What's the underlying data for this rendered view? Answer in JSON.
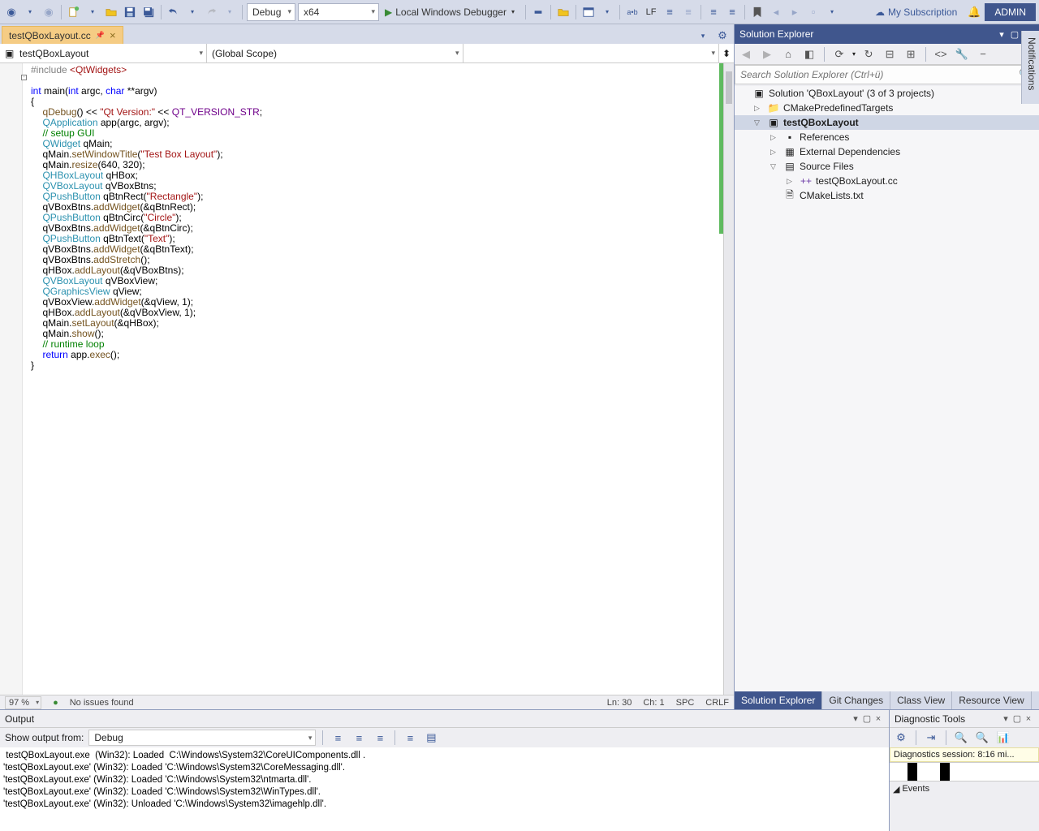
{
  "toolbar": {
    "config": "Debug",
    "platform": "x64",
    "debugger": "Local Windows Debugger",
    "lineEndingLabel": "LF",
    "subscription": "My Subscription",
    "admin": "ADMIN"
  },
  "tab": {
    "name": "testQBoxLayout.cc"
  },
  "nav": {
    "project": "testQBoxLayout",
    "scope": "(Global Scope)",
    "member": ""
  },
  "code": {
    "include": "#include ",
    "includeTarget": "<QtWidgets>",
    "intKw": "int",
    "mainFn": " main(",
    "argc": "int",
    "argcN": " argc, ",
    "charKw": "char",
    "argvN": " **argv)",
    "brace1": "{",
    "qDebug": "qDebug",
    "qDebugRest": "() << ",
    "verStr": "\"Qt Version:\"",
    "llt": " << ",
    "verMac": "QT_VERSION_STR",
    "semi": ";",
    "QApplication": "QApplication",
    "appDecl": " app(argc, argv);",
    "setupCmt": "// setup GUI",
    "QWidget": "QWidget",
    "qMainDecl": " qMain;",
    "setTitle1": "qMain.",
    "setTitleFn": "setWindowTitle",
    "setTitle2": "(",
    "titleStr": "\"Test Box Layout\"",
    "setTitle3": ");",
    "resize1": "qMain.",
    "resizeFn": "resize",
    "resize2": "(640, 320);",
    "QHBox": "QHBoxLayout",
    "qHBoxDecl": " qHBox;",
    "QVBox": "QVBoxLayout",
    "qVBtnsDecl": " qVBoxBtns;",
    "QPush": "QPushButton",
    "btnRect1": " qBtnRect(",
    "rectStr": "\"Rectangle\"",
    "close": ");",
    "addW1": "qVBoxBtns.",
    "addWFn": "addWidget",
    "addRect": "(&qBtnRect);",
    "btnCirc1": " qBtnCirc(",
    "circStr": "\"Circle\"",
    "addCirc": "(&qBtnCirc);",
    "btnText1": " qBtnText(",
    "textStr": "\"Text\"",
    "addText": "(&qBtnText);",
    "stretch1": "qVBoxBtns.",
    "stretchFn": "addStretch",
    "stretch2": "();",
    "addL1": "qHBox.",
    "addLFn": "addLayout",
    "addLBtns": "(&qVBoxBtns);",
    "qVViewDecl": " qVBoxView;",
    "QGView": "QGraphicsView",
    "qViewDecl": " qView;",
    "addView1": "qVBoxView.",
    "addView2": "(&qView, 1);",
    "addLView": "(&qVBoxView, 1);",
    "setLay1": "qMain.",
    "setLayFn": "setLayout",
    "setLay2": "(&qHBox);",
    "show1": "qMain.",
    "showFn": "show",
    "show2": "();",
    "loopCmt": "// runtime loop",
    "returnKw": "return",
    "retRest": " app.",
    "execFn": "exec",
    "retEnd": "();",
    "brace2": "}"
  },
  "status": {
    "zoom": "97 %",
    "issues": "No issues found",
    "line": "Ln: 30",
    "col": "Ch: 1",
    "ins": "SPC",
    "eol": "CRLF"
  },
  "solutionExplorer": {
    "title": "Solution Explorer",
    "searchPlaceholder": "Search Solution Explorer (Ctrl+ü)",
    "solution": "Solution 'QBoxLayout' (3 of 3 projects)",
    "cmakeTargets": "CMakePredefinedTargets",
    "project": "testQBoxLayout",
    "references": "References",
    "extDeps": "External Dependencies",
    "srcFiles": "Source Files",
    "srcFile1": "testQBoxLayout.cc",
    "cmakelists": "CMakeLists.txt",
    "tabs": {
      "se": "Solution Explorer",
      "git": "Git Changes",
      "cls": "Class View",
      "res": "Resource View"
    }
  },
  "output": {
    "title": "Output",
    "showLabel": "Show output from:",
    "source": "Debug",
    "lines": [
      " testQBoxLayout.exe  (Win32): Loaded  C:\\Windows\\System32\\CoreUIComponents.dll .",
      "'testQBoxLayout.exe' (Win32): Loaded 'C:\\Windows\\System32\\CoreMessaging.dll'.",
      "'testQBoxLayout.exe' (Win32): Loaded 'C:\\Windows\\System32\\ntmarta.dll'.",
      "'testQBoxLayout.exe' (Win32): Loaded 'C:\\Windows\\System32\\WinTypes.dll'.",
      "'testQBoxLayout.exe' (Win32): Unloaded 'C:\\Windows\\System32\\imagehlp.dll'."
    ]
  },
  "diag": {
    "title": "Diagnostic Tools",
    "session": "Diagnostics session: 8:16 mi...",
    "events": "Events"
  },
  "vtab": "Notifications"
}
